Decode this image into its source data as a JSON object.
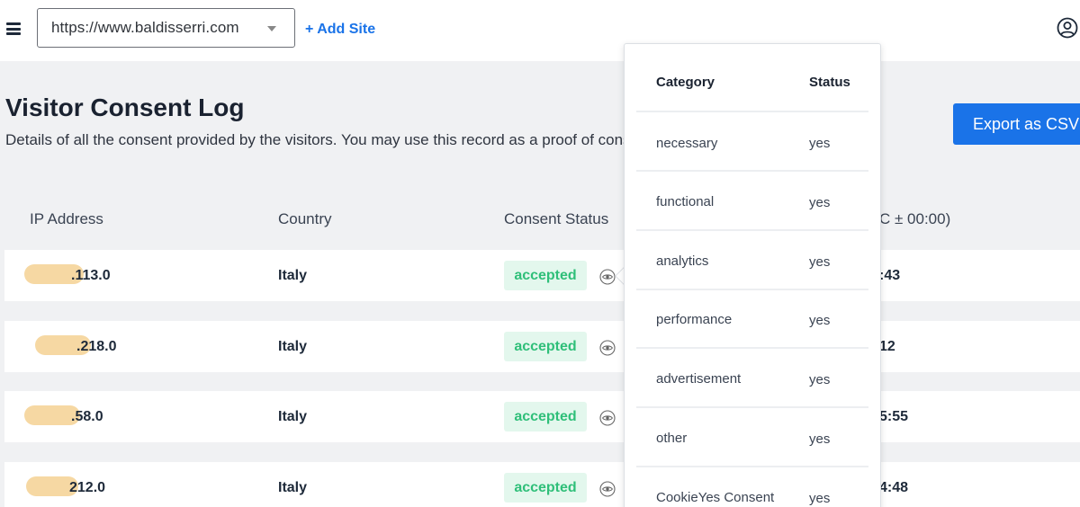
{
  "header": {
    "site_url": "https://www.baldisserri.com",
    "add_site_label": "+ Add Site"
  },
  "page": {
    "title": "Visitor Consent Log",
    "description": "Details of all the consent provided by the visitors. You may use this record as a proof of consent.",
    "export_label": "Export as CSV"
  },
  "table": {
    "headers": {
      "ip": "IP Address",
      "country": "Country",
      "status": "Consent Status",
      "date": "C ± 00:00)"
    },
    "rows": [
      {
        "ip_visible": ".113.0",
        "country": "Italy",
        "status": "accepted",
        "date_visible": ":43"
      },
      {
        "ip_visible": ".218.0",
        "country": "Italy",
        "status": "accepted",
        "date_visible": "12"
      },
      {
        "ip_visible": ".58.0",
        "country": "Italy",
        "status": "accepted",
        "date_visible": "5:55"
      },
      {
        "ip_visible": "212.0",
        "country": "Italy",
        "status": "accepted",
        "date_visible": "4:48"
      }
    ]
  },
  "popup": {
    "headers": {
      "category": "Category",
      "status": "Status"
    },
    "items": [
      {
        "category": "necessary",
        "status": "yes"
      },
      {
        "category": "functional",
        "status": "yes"
      },
      {
        "category": "analytics",
        "status": "yes"
      },
      {
        "category": "performance",
        "status": "yes"
      },
      {
        "category": "advertisement",
        "status": "yes"
      },
      {
        "category": "other",
        "status": "yes"
      },
      {
        "category": "CookieYes Consent",
        "status": "yes"
      }
    ]
  },
  "colors": {
    "accent": "#1a73e8",
    "accepted_bg": "#e3f7ed",
    "accepted_text": "#2fbf79",
    "page_bg": "#f0f1f3",
    "redaction": "#f6d8a3"
  },
  "icons": {
    "menu": "hamburger-icon",
    "dropdown": "caret-down-icon",
    "user": "user-circle-icon",
    "view": "eye-icon"
  }
}
